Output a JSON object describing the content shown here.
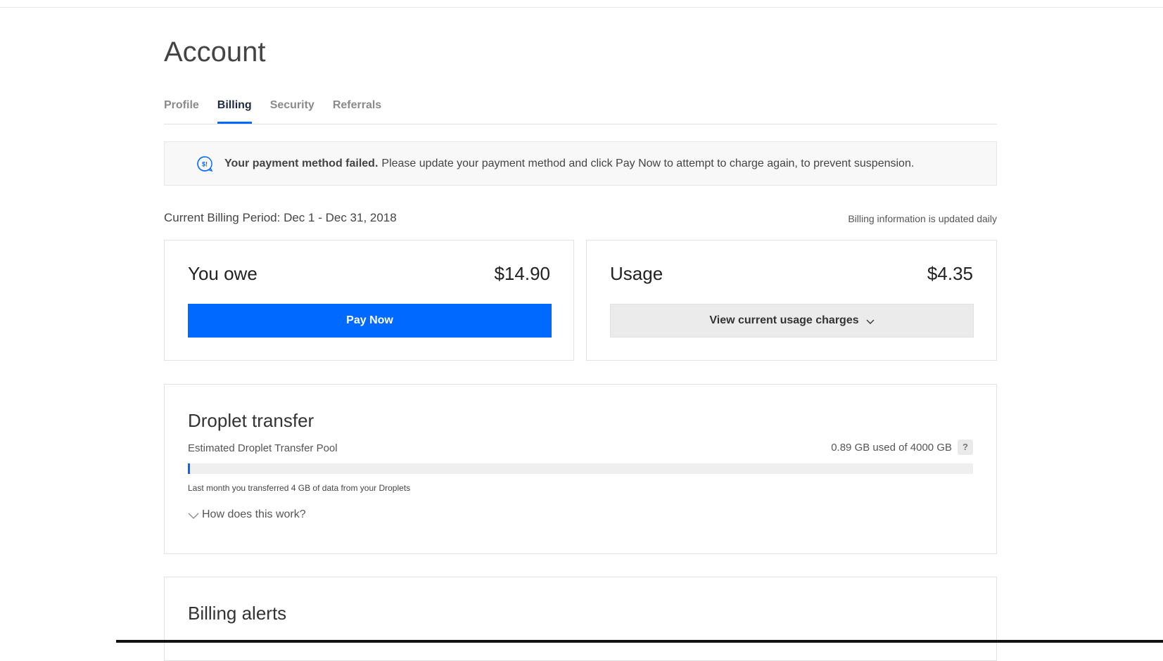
{
  "page": {
    "title": "Account"
  },
  "tabs": [
    {
      "label": "Profile",
      "active": false
    },
    {
      "label": "Billing",
      "active": true
    },
    {
      "label": "Security",
      "active": false
    },
    {
      "label": "Referrals",
      "active": false
    }
  ],
  "alert": {
    "icon": "billing-alert-icon",
    "strong": "Your payment method failed.",
    "message": "Please update your payment method and click Pay Now to attempt to charge again, to prevent suspension."
  },
  "billing_period": {
    "label": "Current Billing Period: Dec 1 - Dec 31, 2018",
    "note": "Billing information is updated daily"
  },
  "owe_card": {
    "label": "You owe",
    "amount": "$14.90",
    "button": "Pay Now"
  },
  "usage_card": {
    "label": "Usage",
    "amount": "$4.35",
    "button": "View current usage charges"
  },
  "droplet_transfer": {
    "title": "Droplet transfer",
    "pool_label": "Estimated Droplet Transfer Pool",
    "pool_value": "0.89 GB used of 4000 GB",
    "help": "?",
    "used_gb": 0.89,
    "total_gb": 4000,
    "last_month": "Last month you transferred 4 GB of data from your Droplets",
    "how_link": "How does this work?"
  },
  "billing_alerts": {
    "title": "Billing alerts"
  },
  "colors": {
    "accent": "#0069ff",
    "text": "#333333",
    "muted": "#8a8a8a"
  }
}
